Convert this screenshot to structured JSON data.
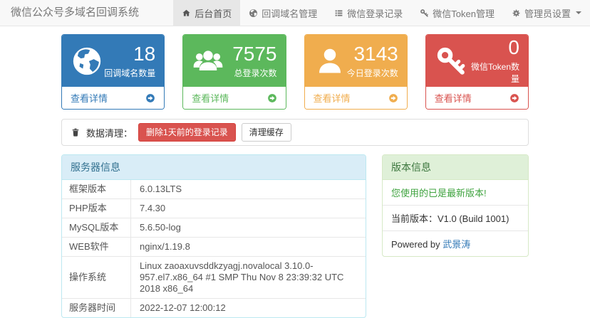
{
  "navbar": {
    "brand": "微信公众号多域名回调系统",
    "items": [
      {
        "label": "后台首页",
        "icon": "home-icon",
        "active": true
      },
      {
        "label": "回调域名管理",
        "icon": "globe-icon",
        "active": false
      },
      {
        "label": "微信登录记录",
        "icon": "list-icon",
        "active": false
      },
      {
        "label": "微信Token管理",
        "icon": "key-icon",
        "active": false
      },
      {
        "label": "管理员设置",
        "icon": "gear-icon",
        "active": false,
        "has_caret": true
      }
    ]
  },
  "stats": [
    {
      "value": "18",
      "label": "回调域名数量",
      "link": "查看详情",
      "icon": "globe-icon",
      "color": "#337ab7"
    },
    {
      "value": "7575",
      "label": "总登录次数",
      "link": "查看详情",
      "icon": "users-icon",
      "color": "#5cb85c"
    },
    {
      "value": "3143",
      "label": "今日登录次数",
      "link": "查看详情",
      "icon": "user-icon",
      "color": "#f0ad4e"
    },
    {
      "value": "0",
      "label": "微信Token数量",
      "link": "查看详情",
      "icon": "key-icon",
      "color": "#d9534f"
    }
  ],
  "cleanup": {
    "icon": "trash-icon",
    "label": "数据清理：",
    "delete_button": "删除1天前的登录记录",
    "cache_button": "清理缓存"
  },
  "server_info": {
    "title": "服务器信息",
    "rows": [
      {
        "label": "框架版本",
        "value": "6.0.13LTS"
      },
      {
        "label": "PHP版本",
        "value": "7.4.30"
      },
      {
        "label": "MySQL版本",
        "value": "5.6.50-log"
      },
      {
        "label": "WEB软件",
        "value": "nginx/1.19.8"
      },
      {
        "label": "操作系统",
        "value": "Linux zaoaxuvsddkzyagj.novalocal 3.10.0-957.el7.x86_64 #1 SMP Thu Nov 8 23:39:32 UTC 2018 x86_64"
      },
      {
        "label": "服务器时间",
        "value": "2022-12-07 12:00:12"
      }
    ]
  },
  "version_info": {
    "title": "版本信息",
    "latest_text": "您使用的已是最新版本!",
    "current_version": "当前版本：V1.0 (Build 1001)",
    "powered_by": "Powered by ",
    "powered_by_link": "武景涛"
  },
  "colors": {
    "primary": "#337ab7",
    "success": "#5cb85c",
    "warning": "#f0ad4e",
    "danger": "#d9534f",
    "navbar_bg": "#f8f8f8",
    "navbar_active_bg": "#e7e7e7",
    "info_heading_bg": "#d9edf7",
    "info_heading_text": "#31708f",
    "success_heading_bg": "#dff0d8",
    "success_heading_text": "#3c763e",
    "latest_version_text": "#3fa33f",
    "link": "#337ab7"
  }
}
